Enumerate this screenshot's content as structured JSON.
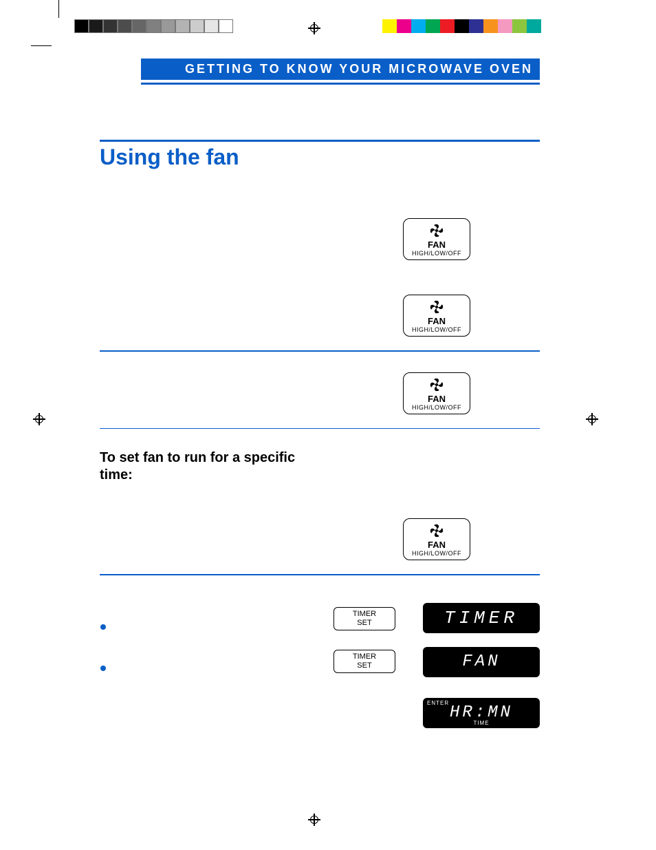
{
  "header": {
    "banner": "GETTING TO KNOW YOUR MICROWAVE OVEN",
    "section_title": "Using the fan",
    "sub_heading": "To set fan to run for a specific time:"
  },
  "buttons": {
    "fan_label_main": "FAN",
    "fan_label_sub": "HIGH/LOW/OFF",
    "timer_label_line1": "TIMER",
    "timer_label_line2": "SET"
  },
  "lcd": {
    "timer": "TIMER",
    "fan": "FAN",
    "hrmn_main": "HR:MN",
    "hrmn_top": "ENTER",
    "hrmn_bottom": "TIME"
  },
  "color_bars": {
    "left_grays": [
      "#000000",
      "#1a1a1a",
      "#333333",
      "#4d4d4d",
      "#666666",
      "#808080",
      "#999999",
      "#b3b3b3",
      "#cccccc",
      "#e5e5e5",
      "#ffffff"
    ],
    "right_colors": [
      "#fff200",
      "#ec008b",
      "#00adee",
      "#00a651",
      "#ed1c24",
      "#000000",
      "#2e3092",
      "#f7931d",
      "#f49ac1",
      "#8cc63f",
      "#00a99d"
    ]
  }
}
